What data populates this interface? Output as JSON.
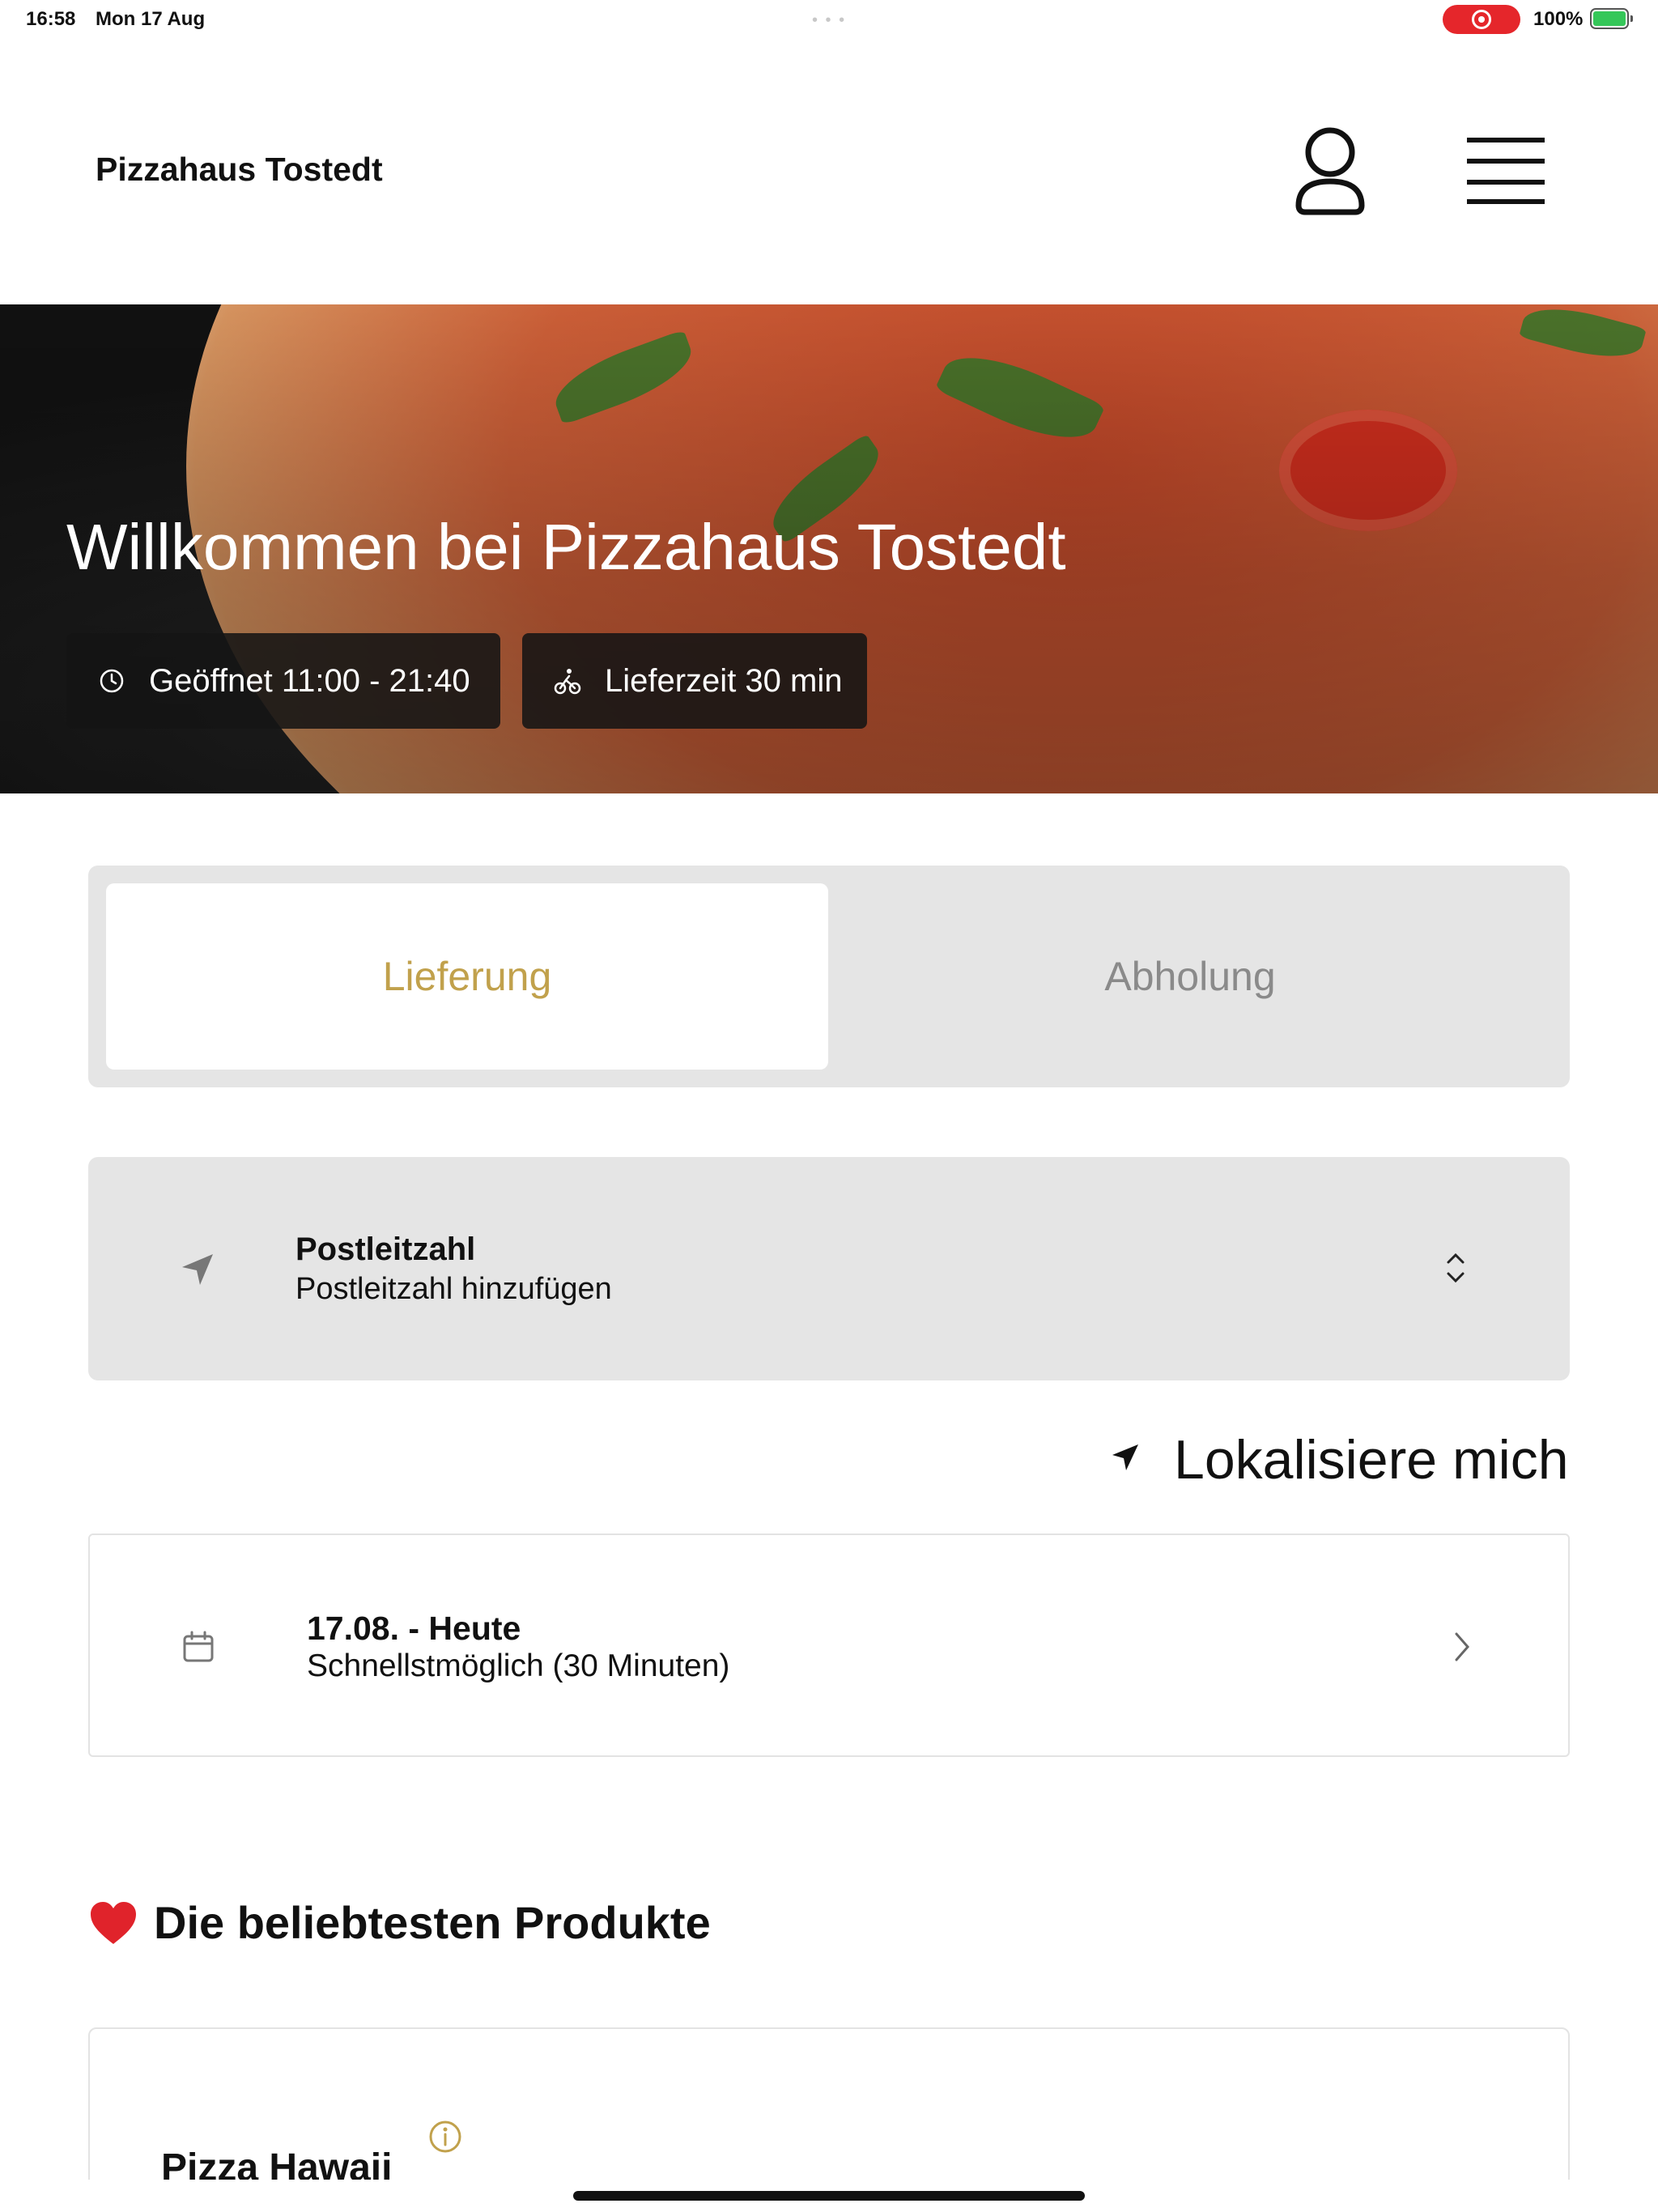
{
  "status_bar": {
    "time": "16:58",
    "date": "Mon 17 Aug",
    "battery_percent": "100%",
    "recording_color": "#e5262b",
    "battery_color": "#35c759"
  },
  "header": {
    "title": "Pizzahaus Tostedt",
    "account_icon": "person-icon",
    "menu_icon": "hamburger-menu-icon"
  },
  "hero": {
    "title": "Willkommen bei Pizzahaus Tostedt",
    "opening_hours": "Geöffnet 11:00 - 21:40",
    "delivery_time": "Lieferzeit 30 min"
  },
  "order_mode": {
    "options": [
      {
        "label": "Lieferung",
        "active": true
      },
      {
        "label": "Abholung",
        "active": false
      }
    ],
    "accent_color": "#c1a14c"
  },
  "postal_code": {
    "label": "Postleitzahl",
    "value": "Postleitzahl hinzufügen"
  },
  "locate_me": {
    "label": "Lokalisiere mich"
  },
  "delivery_date": {
    "title": "17.08. - Heute",
    "subtitle": "Schnellstmöglich (30 Minuten)"
  },
  "popular": {
    "heading": "Die beliebtesten Produkte",
    "products": [
      {
        "name": "Pizza Hawaii"
      }
    ]
  }
}
